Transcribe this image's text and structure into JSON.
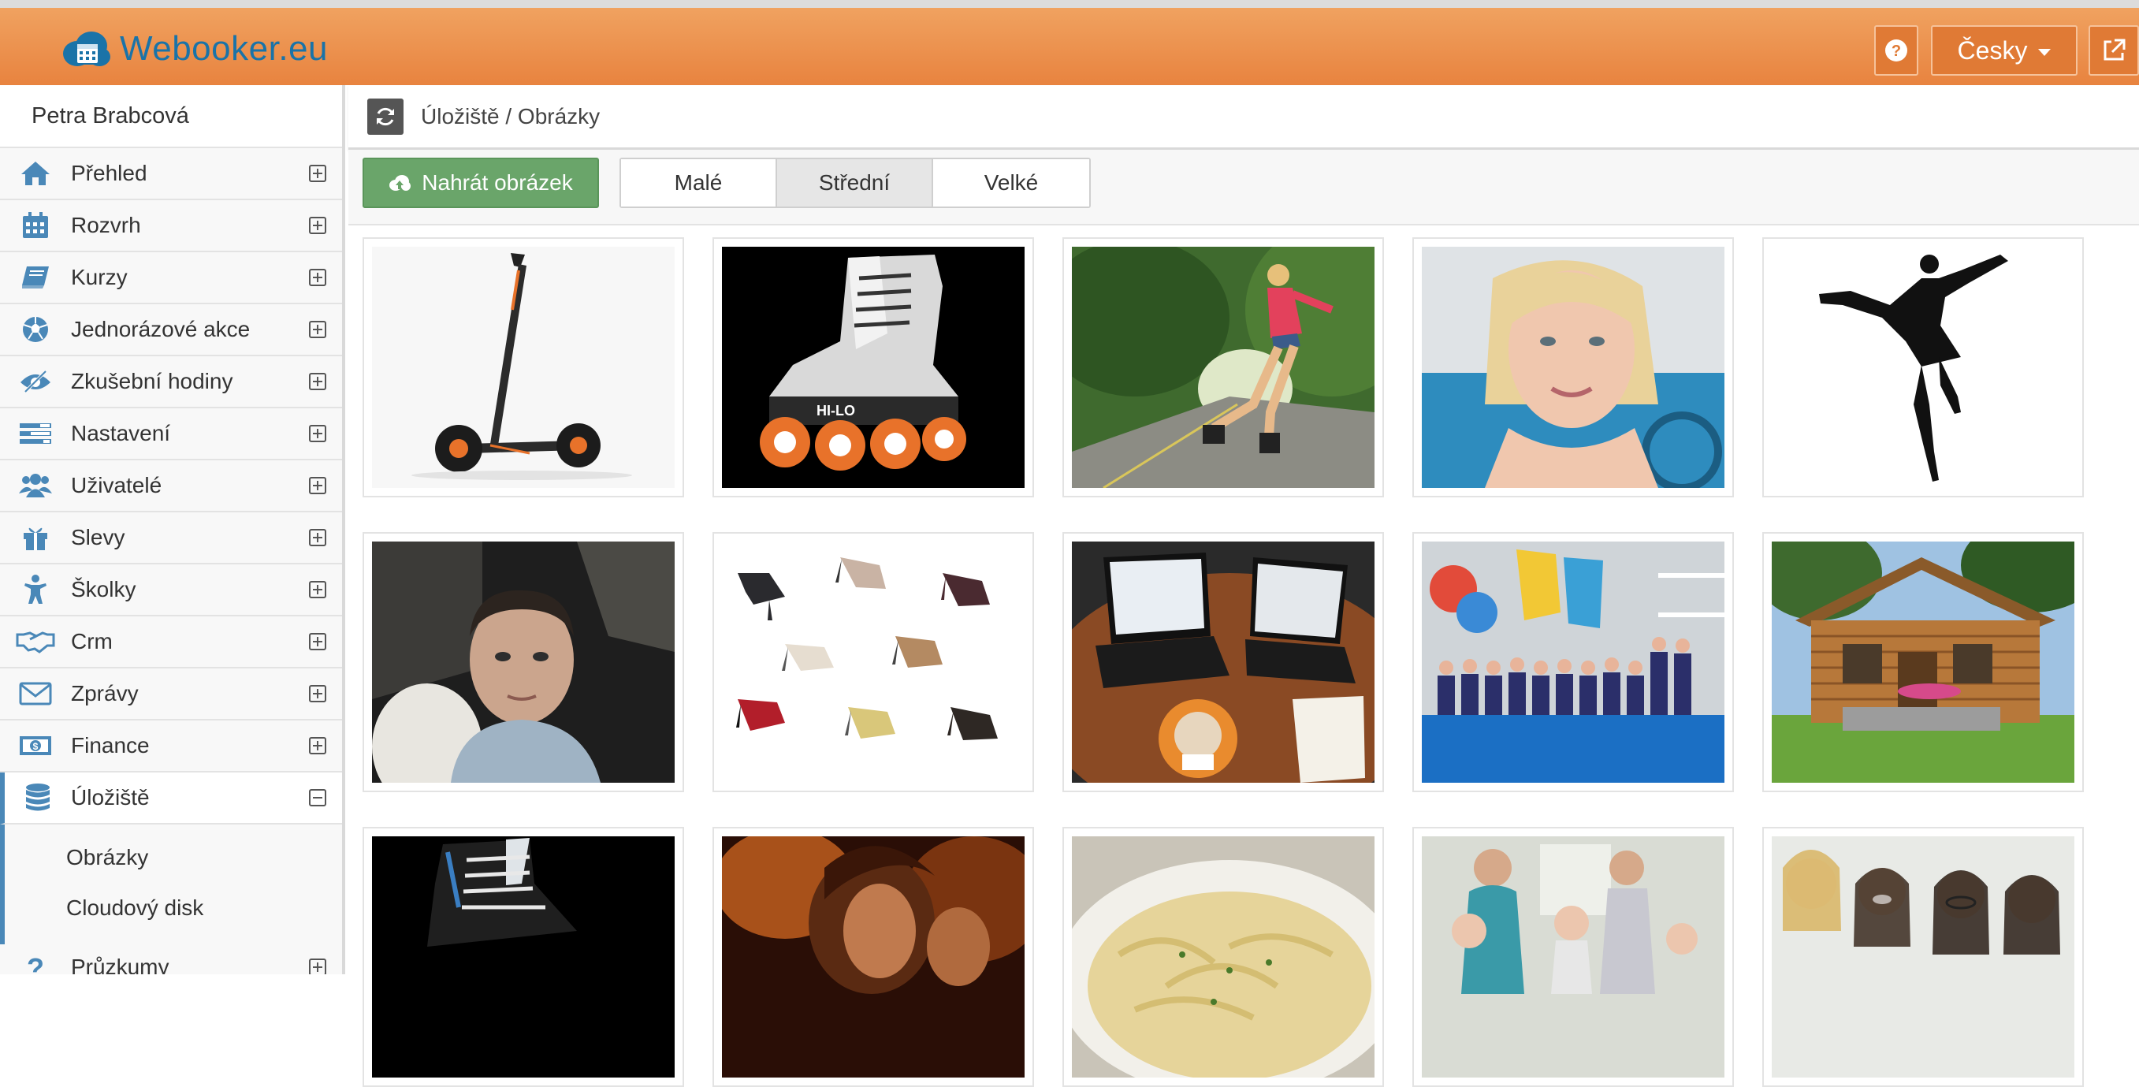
{
  "app": {
    "logo_text": "Webooker.eu",
    "language_label": "Česky",
    "accent_color": "#e8833f",
    "brand_color": "#1a73a8"
  },
  "sidebar": {
    "user_name": "Petra Brabcová",
    "items": [
      {
        "label": "Přehled",
        "icon": "home-icon",
        "expanded": false
      },
      {
        "label": "Rozvrh",
        "icon": "calendar-icon",
        "expanded": false
      },
      {
        "label": "Kurzy",
        "icon": "book-icon",
        "expanded": false
      },
      {
        "label": "Jednorázové akce",
        "icon": "soccer-ball-icon",
        "expanded": false
      },
      {
        "label": "Zkušební hodiny",
        "icon": "eye-slash-icon",
        "expanded": false
      },
      {
        "label": "Nastavení",
        "icon": "tasks-icon",
        "expanded": false
      },
      {
        "label": "Uživatelé",
        "icon": "users-icon",
        "expanded": false
      },
      {
        "label": "Slevy",
        "icon": "gift-icon",
        "expanded": false
      },
      {
        "label": "Školky",
        "icon": "child-icon",
        "expanded": false
      },
      {
        "label": "Crm",
        "icon": "handshake-icon",
        "expanded": false
      },
      {
        "label": "Zprávy",
        "icon": "envelope-icon",
        "expanded": false
      },
      {
        "label": "Finance",
        "icon": "money-icon",
        "expanded": false
      },
      {
        "label": "Úložiště",
        "icon": "database-icon",
        "expanded": true
      },
      {
        "label": "Průzkumy",
        "icon": "question-icon",
        "expanded": false
      }
    ],
    "submenu": [
      "Obrázky",
      "Cloudový disk"
    ]
  },
  "breadcrumb": {
    "text": "Úložiště / Obrázky"
  },
  "toolbar": {
    "upload_label": "Nahrát obrázek",
    "sizes": [
      "Malé",
      "Střední",
      "Velké"
    ],
    "selected_size": "Střední"
  },
  "gallery": {
    "images": [
      "electric-scooter",
      "inline-hockey-skate",
      "rollerblading-woman",
      "woman-portrait",
      "ballerina-silhouette",
      "man-portrait",
      "dance-shoes",
      "laptops-on-table",
      "children-at-pool",
      "wooden-cabin",
      "ice-skate",
      "dancing-couple",
      "pasta-plate",
      "mothers-with-babies",
      "women-group"
    ]
  }
}
